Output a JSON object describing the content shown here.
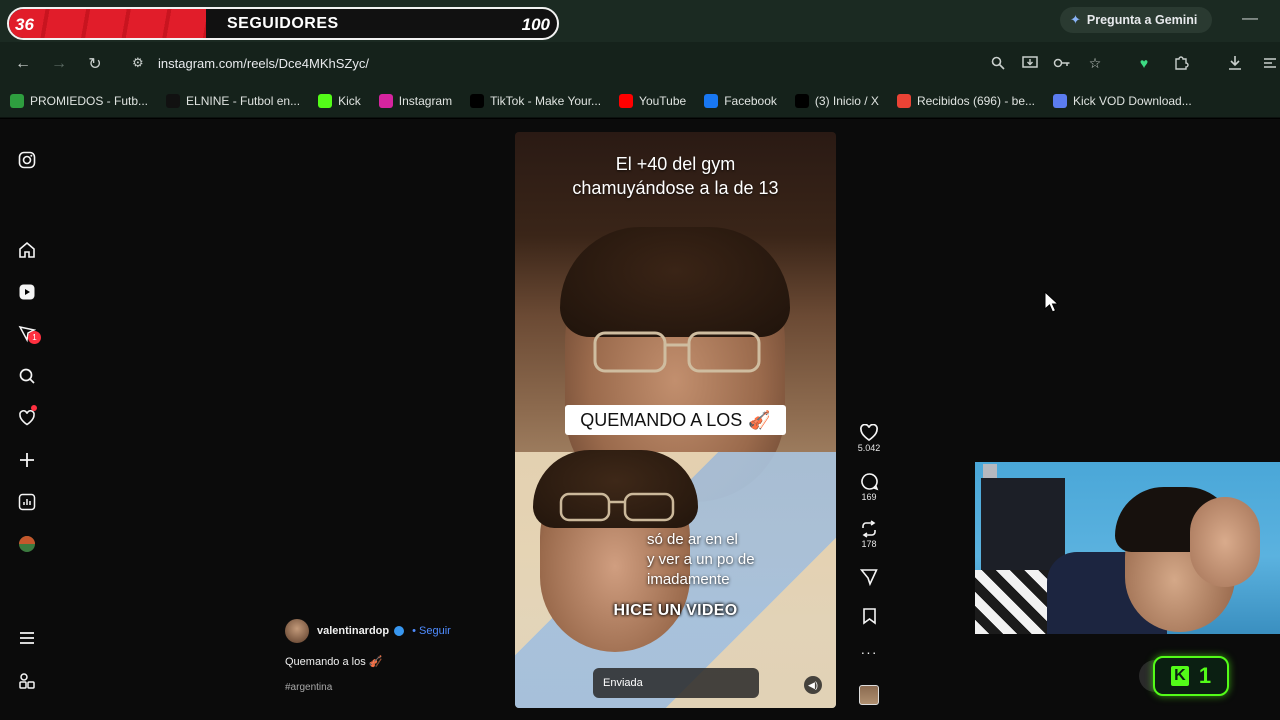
{
  "overlay": {
    "followers_current": "36",
    "followers_label": "SEGUIDORES",
    "followers_goal": "100",
    "progress_fraction": 0.36
  },
  "browser": {
    "gemini_label": "Pregunta a Gemini",
    "url": "instagram.com/reels/Dce4MKhSZyc/",
    "bookmarks": [
      {
        "label": "PROMIEDOS - Futb...",
        "icon": "promiedos-icon",
        "color": "#2e9e3f"
      },
      {
        "label": "ELNINE - Futbol en...",
        "icon": "elnine-icon",
        "color": "#111111"
      },
      {
        "label": "Kick",
        "icon": "kick-icon",
        "color": "#53fc18"
      },
      {
        "label": "Instagram",
        "icon": "instagram-icon",
        "color": "#d6249f"
      },
      {
        "label": "TikTok - Make Your...",
        "icon": "tiktok-icon",
        "color": "#000000"
      },
      {
        "label": "YouTube",
        "icon": "youtube-icon",
        "color": "#ff0000"
      },
      {
        "label": "Facebook",
        "icon": "facebook-icon",
        "color": "#1877f2"
      },
      {
        "label": "(3) Inicio / X",
        "icon": "x-icon",
        "color": "#000000"
      },
      {
        "label": "Recibidos (696) - be...",
        "icon": "gmail-icon",
        "color": "#ea4335"
      },
      {
        "label": "Kick VOD Download...",
        "icon": "kick-vod-icon",
        "color": "#5b7cf0"
      }
    ]
  },
  "reel": {
    "top_caption": [
      "El +40 del gym",
      "chamuyándose a la de 13"
    ],
    "banner": "QUEMANDO A LOS",
    "banner_emoji": "🎻",
    "sub_caption": [
      "só de  ar en el",
      "y ver a un  po de",
      "imadamente"
    ],
    "shout": "HICE UN VIDEO",
    "sent_label": "Enviada",
    "likes": "5.042",
    "comments": "169",
    "reposts": "178"
  },
  "author": {
    "username": "valentinardop",
    "follow_label": "• Seguir",
    "caption": "Quemando a los 🎻",
    "hashtag": "#argentina"
  },
  "kick": {
    "count": "1"
  }
}
